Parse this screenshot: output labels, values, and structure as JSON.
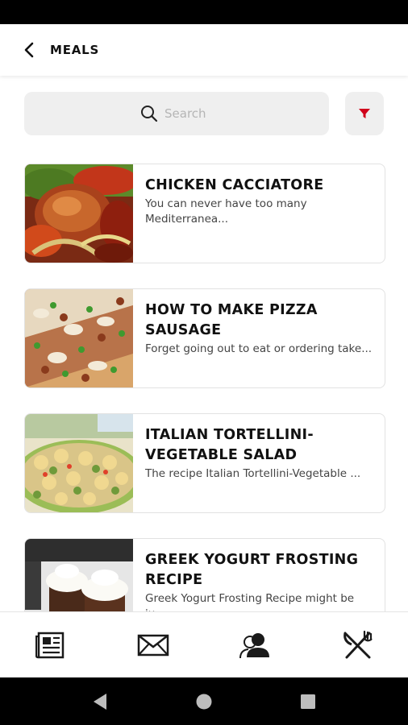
{
  "header": {
    "title": "MEALS"
  },
  "search": {
    "placeholder": "Search"
  },
  "meals": [
    {
      "title": "CHICKEN CACCIATORE",
      "description": "You can never have too many Mediterranea..."
    },
    {
      "title": "HOW TO MAKE PIZZA SAUSAGE",
      "description": "Forget going out to eat or ordering take..."
    },
    {
      "title": "ITALIAN TORTELLINI-VEGETABLE SALAD",
      "description": "The recipe Italian Tortellini-Vegetable ..."
    },
    {
      "title": "GREEK YOGURT FROSTING RECIPE",
      "description": "Greek Yogurt Frosting Recipe might be ju..."
    }
  ],
  "colors": {
    "accent": "#d0021b",
    "search_bg": "#efefef",
    "nav_icon": "#1a1a1a"
  },
  "bottom_nav": [
    "news-icon",
    "mail-icon",
    "profile-icon",
    "meals-icon"
  ]
}
